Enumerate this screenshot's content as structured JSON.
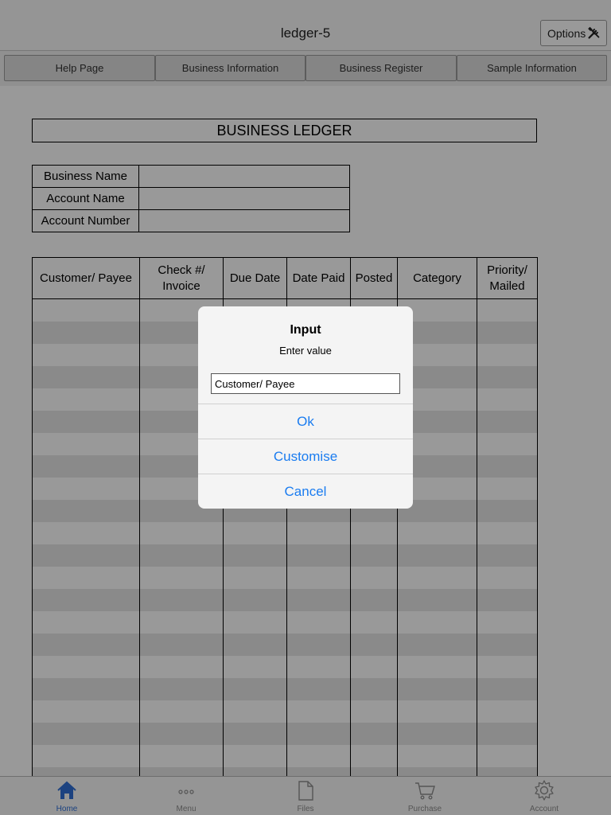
{
  "header": {
    "title": "ledger-5",
    "options_label": "Options"
  },
  "tabs": [
    {
      "label": "Help Page"
    },
    {
      "label": "Business Information"
    },
    {
      "label": "Business Register"
    },
    {
      "label": "Sample Information"
    }
  ],
  "ledger": {
    "title": "BUSINESS LEDGER",
    "info_labels": [
      "Business Name",
      "Account Name",
      "Account Number"
    ],
    "columns": [
      "Customer/ Payee",
      "Check #/ Invoice",
      "Due Date",
      "Date Paid",
      "Posted",
      "Category",
      "Priority/ Mailed"
    ]
  },
  "dialog": {
    "title": "Input",
    "message": "Enter value",
    "input_value": "Customer/ Payee",
    "ok_label": "Ok",
    "customise_label": "Customise",
    "cancel_label": "Cancel"
  },
  "bottom_tabs": [
    {
      "label": "Home",
      "icon": "home-icon",
      "active": true
    },
    {
      "label": "Menu",
      "icon": "more-icon",
      "active": false
    },
    {
      "label": "Files",
      "icon": "file-icon",
      "active": false
    },
    {
      "label": "Purchase",
      "icon": "cart-icon",
      "active": false
    },
    {
      "label": "Account",
      "icon": "gear-icon",
      "active": false
    }
  ],
  "colors": {
    "accent": "#1a7cf0",
    "tab_active": "#2f6fd6",
    "stripe": "#e6e6e6"
  }
}
